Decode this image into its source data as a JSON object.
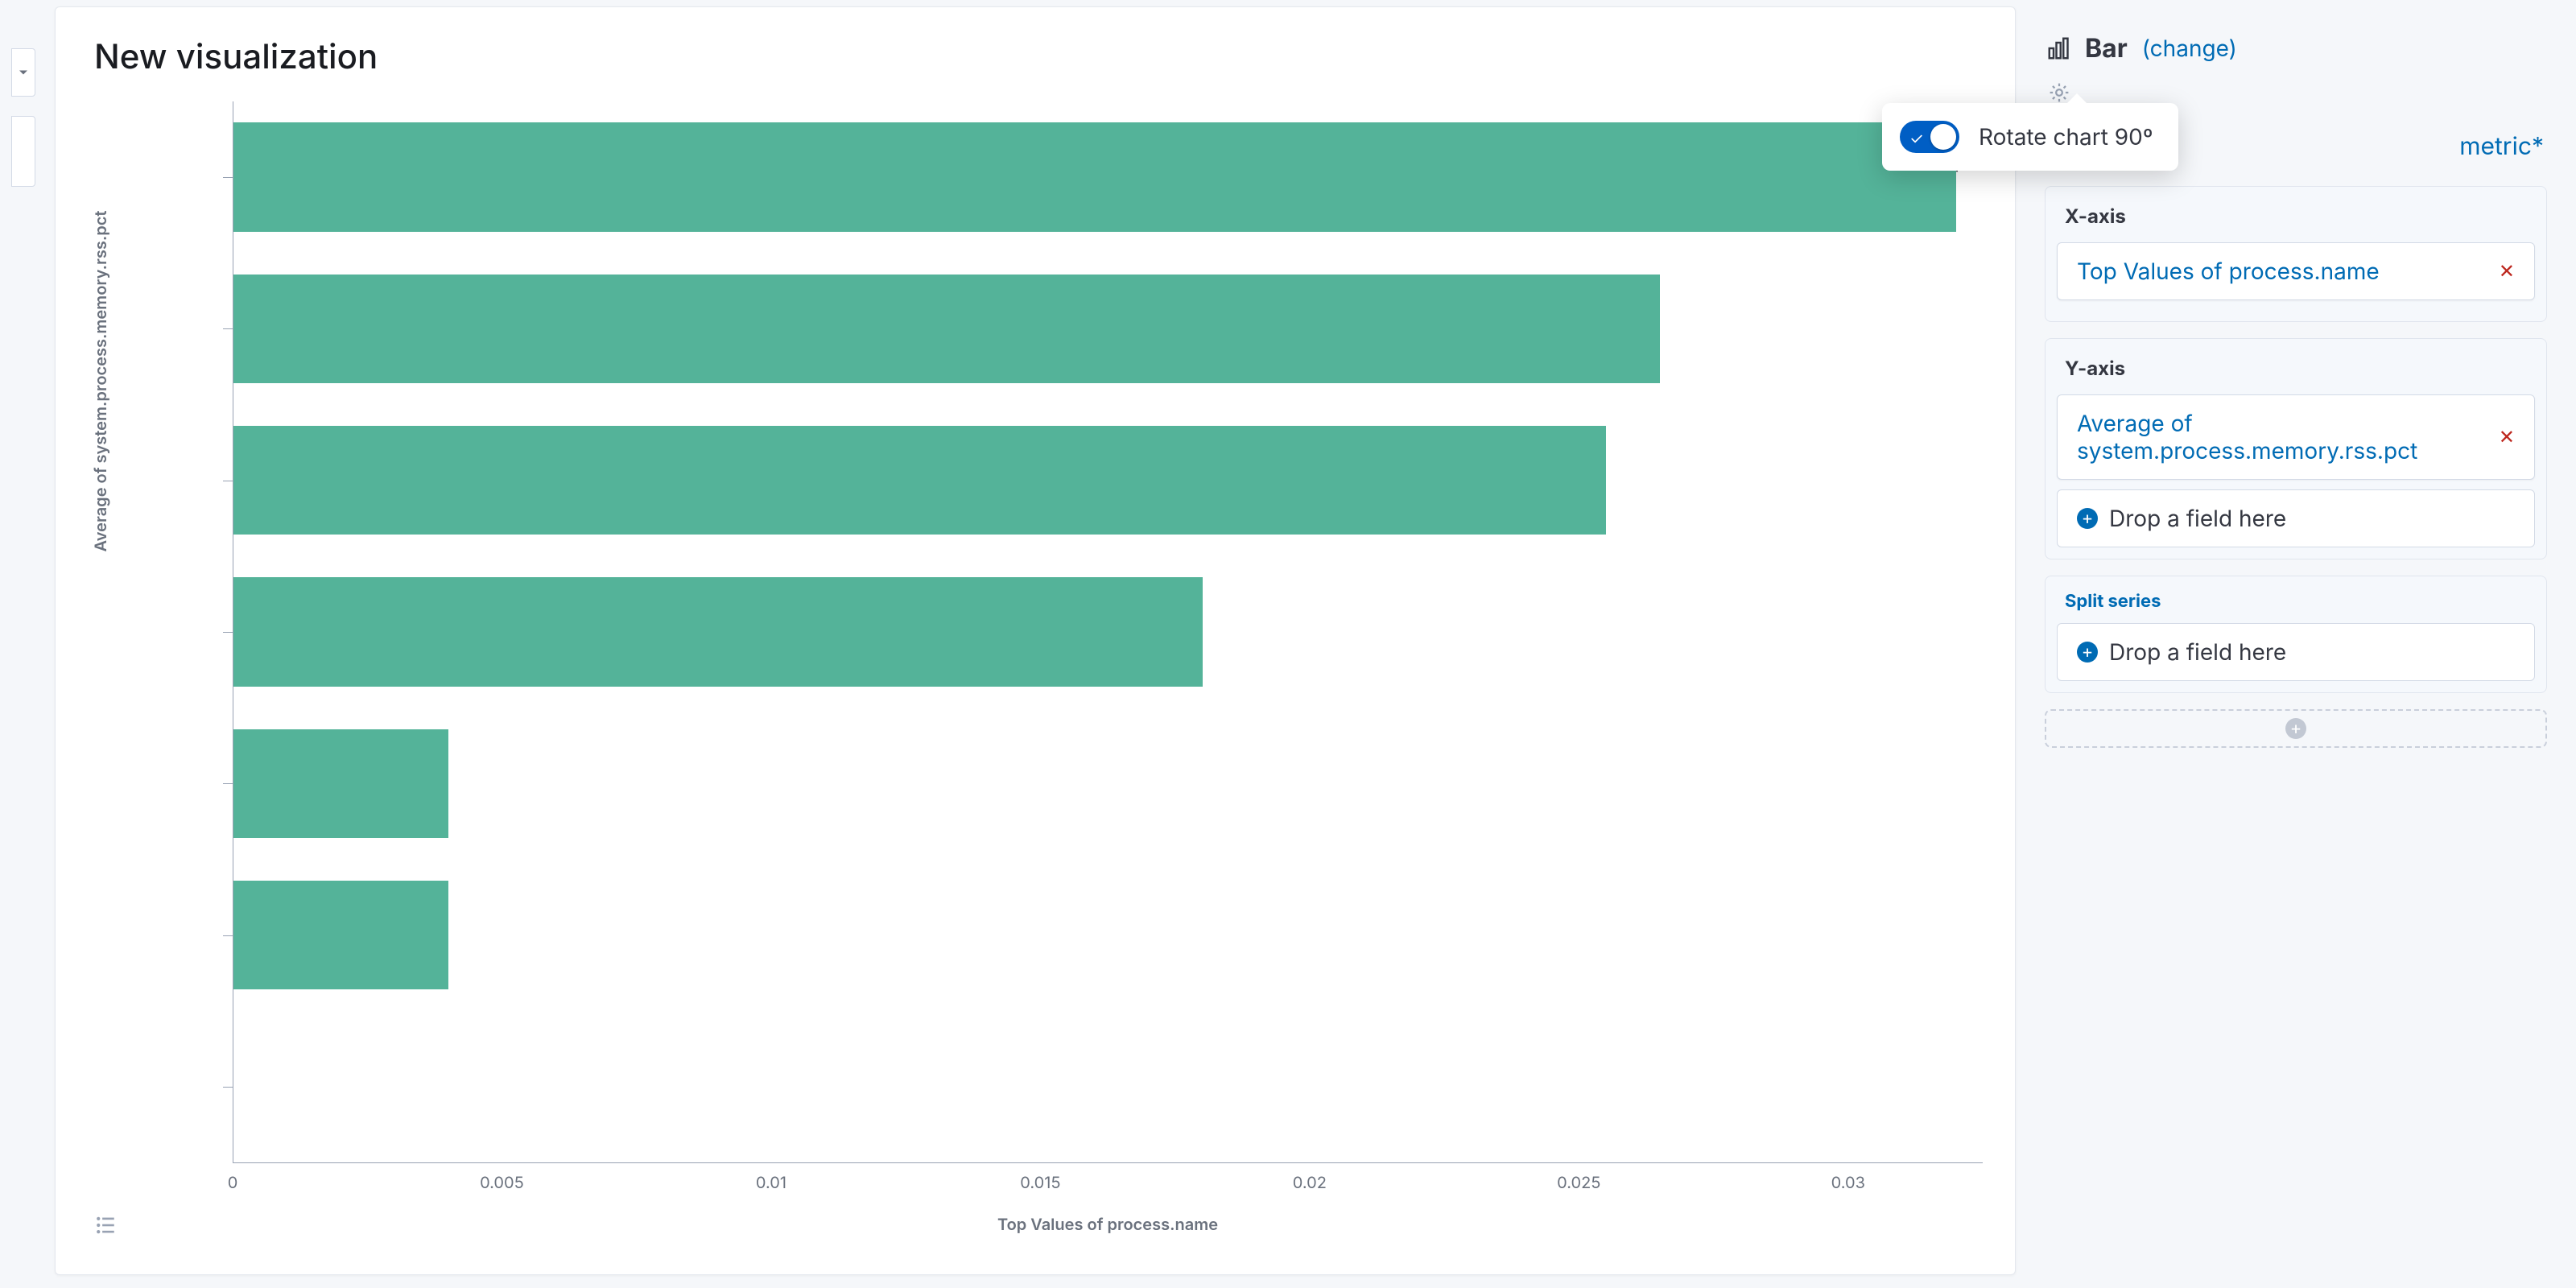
{
  "viz": {
    "title": "New visualization",
    "legend_label": "Average of system.pro",
    "y_axis_label": "Average of system.process.memory.rss.pct",
    "x_axis_label": "Top Values of process.name"
  },
  "sidebar": {
    "chart_type": "Bar",
    "change_label": "(change)",
    "metric_link": "metric*",
    "x_axis_header": "X-axis",
    "x_axis_field": "Top Values of process.name",
    "y_axis_header": "Y-axis",
    "y_axis_field": "Average of system.process.memory.rss.pct",
    "drop_field_label": "Drop a field here",
    "split_header": "Split series"
  },
  "popover": {
    "rotate_label": "Rotate chart 90º"
  },
  "chart_data": {
    "type": "bar",
    "orientation": "horizontal",
    "categories": [
      "",
      "",
      "",
      "",
      "",
      "",
      ""
    ],
    "values": [
      0.032,
      0.0265,
      0.0255,
      0.018,
      0.004,
      0.004,
      0
    ],
    "series_name": "Average of system.process.memory.rss.pct",
    "title": "",
    "xlabel": "Top Values of process.name",
    "ylabel": "Average of system.process.memory.rss.pct",
    "xlim": [
      0,
      0.0325
    ],
    "x_ticks": [
      0,
      0.005,
      0.01,
      0.015,
      0.02,
      0.025,
      0.03
    ],
    "x_tick_labels": [
      "0",
      "0.005",
      "0.01",
      "0.015",
      "0.02",
      "0.025",
      "0.03"
    ],
    "bar_color": "#54b399"
  }
}
